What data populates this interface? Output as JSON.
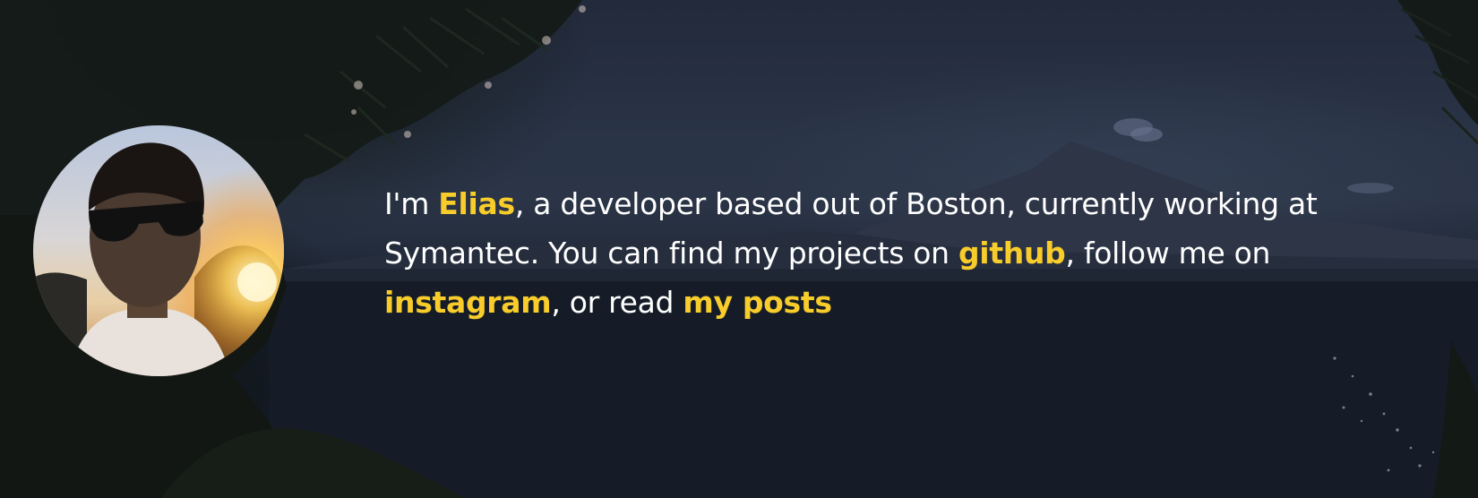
{
  "hero": {
    "avatar_alt": "Profile photo of Elias",
    "bio": {
      "part1": "I'm ",
      "name": "Elias",
      "part2": ", a developer based out of Boston, currently working at Symantec. You can find my projects on ",
      "github_link": "github",
      "part3": ", follow me on ",
      "instagram_link": "instagram",
      "part4": ", or read ",
      "posts_link": "my posts"
    }
  },
  "colors": {
    "accent": "#f7cc2b",
    "text": "#ffffff",
    "background": "#1b2230"
  }
}
